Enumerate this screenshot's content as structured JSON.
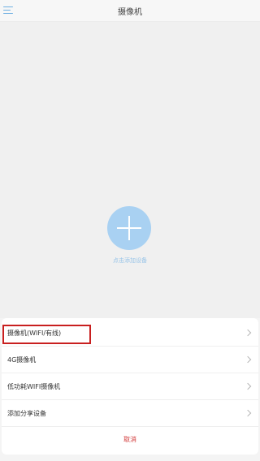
{
  "header": {
    "title": "摄像机",
    "menu_icon": "menu-icon"
  },
  "main": {
    "add_button_icon": "plus-icon",
    "add_hint": "点击添加设备",
    "accent_color": "#a9d1f2"
  },
  "sheet": {
    "items": [
      {
        "label": "摄像机(WIFI/有线)",
        "highlighted": true
      },
      {
        "label": "4G摄像机"
      },
      {
        "label": "低功耗WIFI摄像机"
      },
      {
        "label": "添加分享设备"
      }
    ],
    "cancel_label": "取消",
    "cancel_color": "#d23b3b",
    "highlight_color": "#c81f1f"
  }
}
